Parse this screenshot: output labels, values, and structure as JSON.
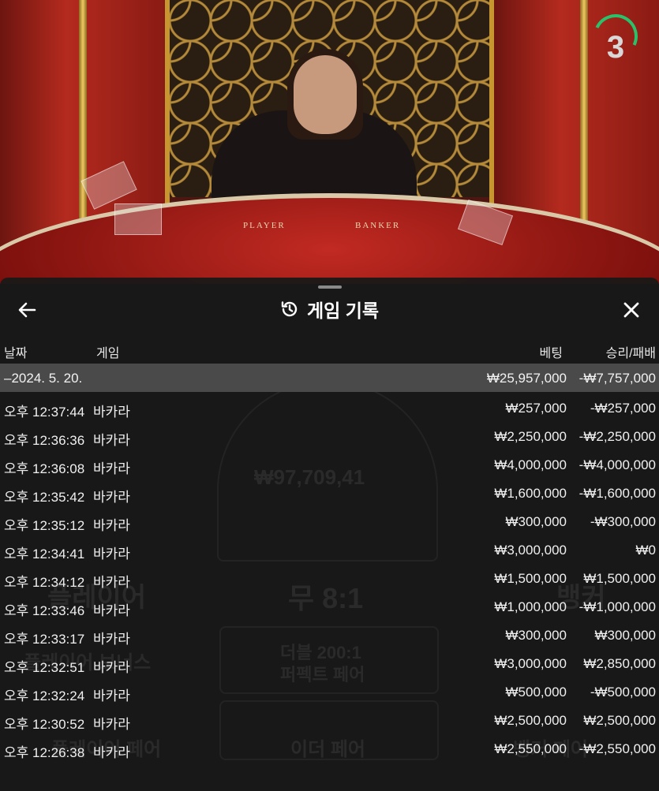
{
  "countdown": {
    "value": "3"
  },
  "table_labels": {
    "player": "PLAYER",
    "banker": "BANKER"
  },
  "history": {
    "title": "게임 기록",
    "columns": {
      "date": "날짜",
      "game": "게임",
      "bet": "베팅",
      "result": "승리/패배"
    },
    "day": {
      "date": "–2024. 5. 20.",
      "bet": "₩25,957,000",
      "result": "-₩7,757,000"
    },
    "rows": [
      {
        "time": "오후 12:37:44",
        "game": "바카라",
        "bet": "₩257,000",
        "result": "-₩257,000"
      },
      {
        "time": "오후 12:36:36",
        "game": "바카라",
        "bet": "₩2,250,000",
        "result": "-₩2,250,000"
      },
      {
        "time": "오후 12:36:08",
        "game": "바카라",
        "bet": "₩4,000,000",
        "result": "-₩4,000,000"
      },
      {
        "time": "오후 12:35:42",
        "game": "바카라",
        "bet": "₩1,600,000",
        "result": "-₩1,600,000"
      },
      {
        "time": "오후 12:35:12",
        "game": "바카라",
        "bet": "₩300,000",
        "result": "-₩300,000"
      },
      {
        "time": "오후 12:34:41",
        "game": "바카라",
        "bet": "₩3,000,000",
        "result": "₩0"
      },
      {
        "time": "오후 12:34:12",
        "game": "바카라",
        "bet": "₩1,500,000",
        "result": "₩1,500,000"
      },
      {
        "time": "오후 12:33:46",
        "game": "바카라",
        "bet": "₩1,000,000",
        "result": "-₩1,000,000"
      },
      {
        "time": "오후 12:33:17",
        "game": "바카라",
        "bet": "₩300,000",
        "result": "₩300,000"
      },
      {
        "time": "오후 12:32:51",
        "game": "바카라",
        "bet": "₩3,000,000",
        "result": "₩2,850,000"
      },
      {
        "time": "오후 12:32:24",
        "game": "바카라",
        "bet": "₩500,000",
        "result": "-₩500,000"
      },
      {
        "time": "오후 12:30:52",
        "game": "바카라",
        "bet": "₩2,500,000",
        "result": "₩2,500,000"
      },
      {
        "time": "오후 12:26:38",
        "game": "바카라",
        "bet": "₩2,550,000",
        "result": "-₩2,550,000"
      }
    ]
  },
  "background_labels": {
    "balance": "₩97,709,41",
    "player": "플레이어",
    "tie": "무 8:1",
    "banker": "뱅커",
    "player_bonus": "플레이어 보너스",
    "double": "더블 200:1",
    "perfect_pair": "퍼펙트 페어",
    "either_pair": "이더 페어",
    "player_pair": "플레이어 페어",
    "banker_pair": "뱅커 페어"
  },
  "icons": {
    "back": "arrow-left-icon",
    "history": "history-icon",
    "close": "close-icon"
  }
}
